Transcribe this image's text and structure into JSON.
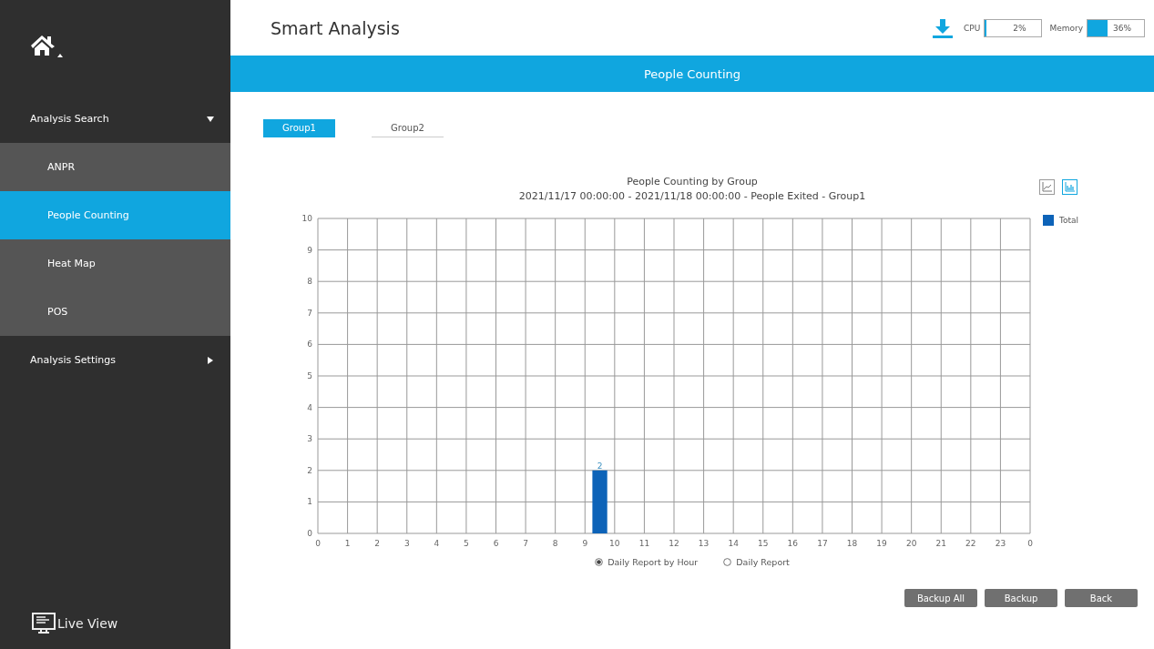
{
  "sidebar": {
    "items": [
      {
        "label": "Analysis Search",
        "expanded": true,
        "children": [
          {
            "label": "ANPR",
            "selected": false
          },
          {
            "label": "People Counting",
            "selected": true
          },
          {
            "label": "Heat Map",
            "selected": false
          },
          {
            "label": "POS",
            "selected": false
          }
        ]
      },
      {
        "label": "Analysis Settings",
        "expanded": false
      }
    ],
    "footer": "Live View"
  },
  "header": {
    "title": "Smart Analysis",
    "cpu": {
      "label": "CPU",
      "reading": "2%",
      "level": 0.02
    },
    "memory": {
      "label": "Memory",
      "reading": "36%",
      "level": 0.36
    }
  },
  "section_title": "People Counting",
  "tabs": [
    {
      "label": "Group1",
      "selected": true
    },
    {
      "label": "Group2",
      "selected": false
    }
  ],
  "chart": {
    "title": "People Counting by Group",
    "subtitle": "2021/11/17 00:00:00 - 2021/11/18 00:00:00 - People Exited - Group1",
    "next_day_label": "0",
    "view_modes": [
      {
        "kind": "line",
        "selected": false
      },
      {
        "kind": "bar",
        "selected": true
      }
    ],
    "chart_data": {
      "type": "bar",
      "x": [
        0.5,
        1.5,
        2.5,
        3.5,
        4.5,
        5.5,
        6.5,
        7.5,
        8.5,
        9.5,
        10.5,
        11.5,
        12.5,
        13.5,
        14.5,
        15.5,
        16.5,
        17.5,
        18.5,
        19.5,
        20.5,
        21.5,
        22.5,
        23.5
      ],
      "series": [
        {
          "name": "Total",
          "color": "#0d63b8",
          "values": [
            0,
            0,
            0,
            0,
            0,
            0,
            0,
            0,
            0,
            2,
            0,
            0,
            0,
            0,
            0,
            0,
            0,
            0,
            0,
            0,
            0,
            0,
            0,
            0
          ]
        }
      ],
      "xlim": [
        0,
        24
      ],
      "ylim": [
        0,
        10
      ],
      "xticks": [
        0,
        1,
        2,
        3,
        4,
        5,
        6,
        7,
        8,
        9,
        10,
        11,
        12,
        13,
        14,
        15,
        16,
        17,
        18,
        19,
        20,
        21,
        22,
        23
      ],
      "yticks": [
        0,
        1,
        2,
        3,
        4,
        5,
        6,
        7,
        8,
        9,
        10
      ],
      "grid": true,
      "value_labels": [
        [
          null,
          null,
          null,
          null,
          null,
          null,
          null,
          null,
          null,
          "2",
          null,
          null,
          null,
          null,
          null,
          null,
          null,
          null,
          null,
          null,
          null,
          null,
          null,
          null
        ]
      ]
    }
  },
  "report_types": [
    {
      "label": "Daily Report by Hour",
      "selected": true
    },
    {
      "label": "Daily Report",
      "selected": false
    }
  ],
  "buttons": [
    "Backup All",
    "Backup",
    "Back"
  ]
}
